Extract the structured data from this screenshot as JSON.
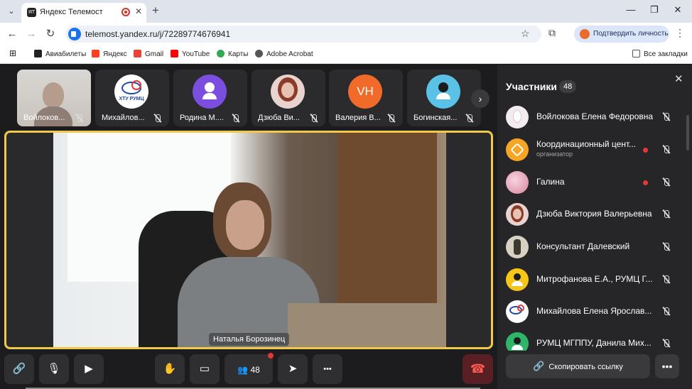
{
  "browser": {
    "tab_title": "Яндекс Телемост",
    "tab_favicon": "ЯТ",
    "url": "telemost.yandex.ru/j/72289774676941",
    "verify_label": "Подтвердить личность",
    "icons": {
      "back": "←",
      "forward": "→",
      "reload": "↻",
      "star": "☆",
      "extensions": "⧉",
      "menu": "⋮",
      "minimize": "—",
      "maximize": "❐",
      "close": "✕",
      "new_tab": "+",
      "tab_close": "✕",
      "tab_list": "⌄",
      "apps": "⊞"
    },
    "bookmarks": [
      {
        "label": "Авиабилеты",
        "color": "#222222"
      },
      {
        "label": "Яндекс",
        "color": "#fc3f1d"
      },
      {
        "label": "Gmail",
        "color": "#ea4335"
      },
      {
        "label": "YouTube",
        "color": "#ff0000"
      },
      {
        "label": "Карты",
        "color": "#34a853"
      },
      {
        "label": "Adobe Acrobat",
        "color": "#555555"
      }
    ],
    "all_bookmarks": "Все закладки"
  },
  "thumbnails": [
    {
      "name": "Войлоков...",
      "type": "photo"
    },
    {
      "name": "Михайлов...",
      "type": "logo",
      "logo_text": "ХТУ РУМЦ",
      "color": "#ffffff"
    },
    {
      "name": "Родина М....",
      "type": "icon",
      "color": "#7b4ee0"
    },
    {
      "name": "Дзюба Ви...",
      "type": "photo-avatar",
      "color": "#e8d3ce"
    },
    {
      "name": "Валерия В...",
      "type": "initials",
      "initials": "VH",
      "color": "#f06a2a"
    },
    {
      "name": "Богинская...",
      "type": "icon",
      "color": "#5bc2e7"
    }
  ],
  "thumbs_next": "›",
  "stage": {
    "speaker_name": "Наталья Борозинец"
  },
  "controls": {
    "link_icon": "🔗",
    "mic_icon": "🎙",
    "camera_icon": "▶",
    "hand_icon": "✋",
    "screen_icon": "▭",
    "participants_count": "48",
    "send_icon": "➤",
    "more_icon": "•••",
    "hangup_icon": "☎"
  },
  "panel": {
    "title": "Участники",
    "count": "48",
    "close_icon": "✕",
    "participants": [
      {
        "name": "Войлокова Елена Федоровна",
        "role": "",
        "dot": false,
        "color": "#f2ecef"
      },
      {
        "name": "Координационный цент...",
        "role": "организатор",
        "dot": true,
        "color": "#f6a623"
      },
      {
        "name": "Галина",
        "role": "",
        "dot": true,
        "color": "#e9b8c8"
      },
      {
        "name": "Дзюба Виктория Валерьевна",
        "role": "",
        "dot": false,
        "color": "#e8d3ce"
      },
      {
        "name": "Консультант Далевский",
        "role": "",
        "dot": false,
        "color": "#d8d0c2"
      },
      {
        "name": "Митрофанова Е.А., РУМЦ Г...",
        "role": "",
        "dot": false,
        "color": "#f5c518"
      },
      {
        "name": "Михайлова Елена Ярослав...",
        "role": "",
        "dot": false,
        "color": "#ffffff"
      },
      {
        "name": "РУМЦ МГППУ, Данила Мих...",
        "role": "",
        "dot": false,
        "color": "#2fb56a"
      }
    ],
    "copy_label": "Скопировать ссылку",
    "copy_icon": "🔗",
    "more_icon": "•••"
  }
}
